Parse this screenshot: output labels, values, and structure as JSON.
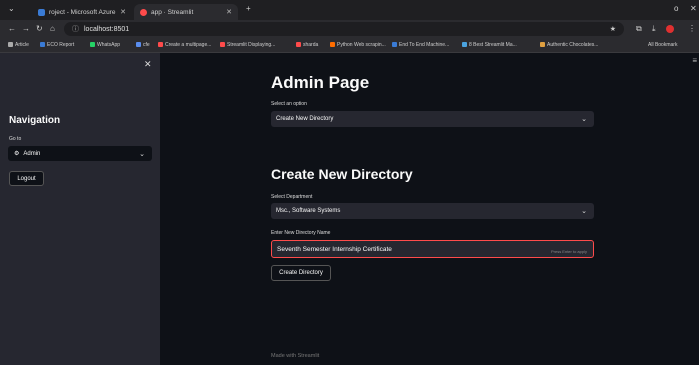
{
  "browser": {
    "tabs": [
      {
        "label": "roject - Microsoft Azure",
        "active": false,
        "icon": "azure-icon"
      },
      {
        "label": "app · Streamlit",
        "active": true,
        "icon": "streamlit-icon"
      }
    ],
    "new_tab": "+",
    "url": "localhost:8501",
    "window_controls": "o",
    "bookmarks": [
      {
        "label": "Article",
        "color": "#aaaaaa"
      },
      {
        "label": "ECO Report",
        "color": "#3a7bd5"
      },
      {
        "label": "WhatsApp",
        "color": "#25d366"
      },
      {
        "label": "cfe",
        "color": "#5a8dee"
      },
      {
        "label": "Create a multipage...",
        "color": "#ff4b4b"
      },
      {
        "label": "Streamlit Displaying...",
        "color": "#ff4b4b"
      },
      {
        "label": "sharda",
        "color": "#ff4b4b"
      },
      {
        "label": "Python Web scrapin...",
        "color": "#ff6d00"
      },
      {
        "label": "End To End Machine...",
        "color": "#3a7bd5"
      },
      {
        "label": "8 Best Streamlit Ma...",
        "color": "#4aa3df"
      },
      {
        "label": "Authentic Chocolates...",
        "color": "#e0a040"
      }
    ],
    "all_bookmarks": "All Bookmark"
  },
  "sidebar": {
    "title": "Navigation",
    "goto_label": "Go to",
    "selected": "Admin",
    "selected_icon": "gear-icon",
    "logout_label": "Logout"
  },
  "main": {
    "page_title": "Admin Page",
    "option_label": "Select an option",
    "option_value": "Create New Directory",
    "section_title": "Create New Directory",
    "department_label": "Select Department",
    "department_value": "Msc., Software Systems",
    "dirname_label": "Enter New Directory Name",
    "dirname_value": "Seventh Semester Internship Certificate",
    "input_hint": "Press Enter to apply",
    "create_button": "Create Directory",
    "footer": "Made with Streamlit"
  },
  "colors": {
    "accent": "#ff4b4b",
    "sidebar_bg": "#262730",
    "main_bg": "#0e1117"
  }
}
